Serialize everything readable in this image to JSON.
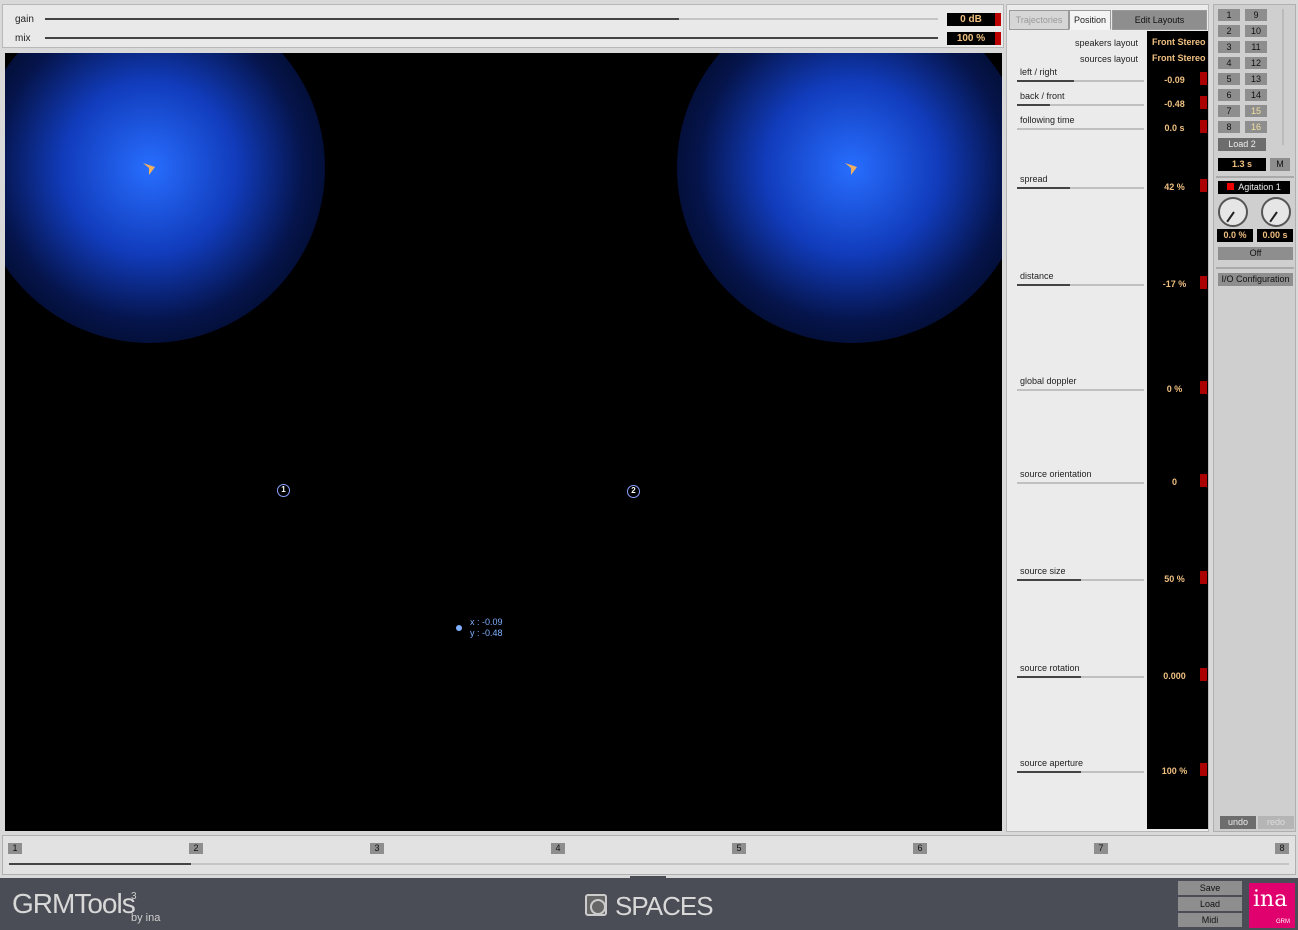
{
  "top": {
    "gain": {
      "label": "gain",
      "value": "0 dB",
      "level": 0.71
    },
    "mix": {
      "label": "mix",
      "value": "100 %",
      "level": 1.0
    }
  },
  "canvas": {
    "speakers": [
      {
        "name": "speaker-left"
      },
      {
        "name": "speaker-right"
      }
    ],
    "sources": [
      {
        "label": "1"
      },
      {
        "label": "2"
      }
    ],
    "cursor": {
      "x_text": "x : -0.09",
      "y_text": "y : -0.48"
    }
  },
  "panel": {
    "tabs": [
      "Trajectories",
      "Position",
      "Edit Layouts"
    ],
    "speakers_layout": {
      "label": "speakers layout",
      "value": "Front Stereo"
    },
    "sources_layout": {
      "label": "sources layout",
      "value": "Front Stereo"
    },
    "params": [
      {
        "label": "left / right",
        "value": "-0.09",
        "level": 0.45
      },
      {
        "label": "back / front",
        "value": "-0.48",
        "level": 0.26
      },
      {
        "label": "following time",
        "value": "0.0 s",
        "level": 0.0
      },
      {
        "label": "spread",
        "value": "42 %",
        "level": 0.42
      },
      {
        "label": "distance",
        "value": "-17 %",
        "level": 0.42
      },
      {
        "label": "global doppler",
        "value": "0 %",
        "level": 0.0
      },
      {
        "label": "source orientation",
        "value": "0",
        "level": 0.0
      },
      {
        "label": "source size",
        "value": "50 %",
        "level": 0.5
      },
      {
        "label": "source rotation",
        "value": "0.000",
        "level": 0.5
      },
      {
        "label": "source aperture",
        "value": "100 %",
        "level": 0.5
      }
    ]
  },
  "side": {
    "presets_left": [
      "1",
      "2",
      "3",
      "4",
      "5",
      "6",
      "7",
      "8"
    ],
    "presets_right": [
      "9",
      "10",
      "11",
      "12",
      "13",
      "14",
      "15",
      "16"
    ],
    "load_label": "Load 2",
    "morph_time": "1.3 s",
    "m_label": "M",
    "agitation_label": "Agitation 1",
    "agitation_amount": "0.0 %",
    "agitation_time": "0.00 s",
    "off_label": "Off",
    "io_label": "I/O Configuration",
    "undo_label": "undo",
    "redo_label": "redo"
  },
  "timeline": {
    "marks": [
      "1",
      "2",
      "3",
      "4",
      "5",
      "6",
      "7",
      "8"
    ]
  },
  "footer": {
    "brand": "GRMTools",
    "brand_sup": "3",
    "brand_sub": "by ina",
    "product": "SPACES",
    "save_label": "Save",
    "load_label": "Load",
    "midi_label": "Midi",
    "logo_text": "ina",
    "logo_sub": "GRM"
  },
  "colors": {
    "accent_value": "#f0c080",
    "glow": "#2a6eff",
    "logo": "#e0006e"
  }
}
